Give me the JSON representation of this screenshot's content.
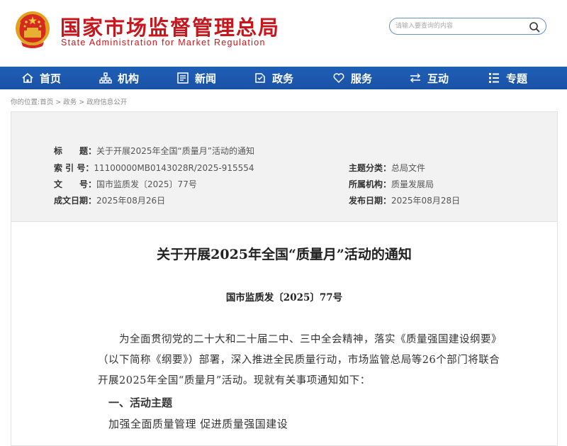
{
  "header": {
    "title": "国家市场监督管理总局",
    "subtitle": "State Administration for Market Regulation",
    "search_placeholder": "请输入要查询的内容",
    "search_icon": "search-icon"
  },
  "nav": {
    "items": [
      {
        "label": "首页",
        "icon": "home-icon"
      },
      {
        "label": "机构",
        "icon": "org-icon"
      },
      {
        "label": "新闻",
        "icon": "news-icon"
      },
      {
        "label": "政务",
        "icon": "affairs-icon"
      },
      {
        "label": "服务",
        "icon": "heart-icon"
      },
      {
        "label": "互动",
        "icon": "exchange-icon"
      },
      {
        "label": "专题",
        "icon": "topic-icon"
      }
    ]
  },
  "breadcrumb": {
    "prefix": "你的位置:",
    "items": [
      "首页",
      "政务",
      "政府信息公开"
    ],
    "separator": " > "
  },
  "meta": {
    "title_key": "标　　题：",
    "title_val": "关于开展2025年全国“质量月”活动的通知",
    "index_key": "索 引 号：",
    "index_val": "11100000MB0143028R/2025-915554",
    "category_key": "主题分类：",
    "category_val": "总局文件",
    "docno_key": "文　　号：",
    "docno_val": "国市监质发〔2025〕77号",
    "org_key": "所属机构：",
    "org_val": "质量发展局",
    "created_key": "成文日期：",
    "created_val": "2025年08月26日",
    "published_key": "发布日期：",
    "published_val": "2025年08月28日"
  },
  "document": {
    "title": "关于开展2025年全国“质量月”活动的通知",
    "number": "国市监质发〔2025〕77号",
    "paragraph": "为全面贯彻党的二十大和二十届二中、三中全会精神，落实《质量强国建设纲要》（以下简称《纲要》）部署，深入推进全民质量行动，市场监管总局等26个部门将联合开展2025年全国“质量月”活动。现就有关事项通知如下：",
    "section1_head": "一、活动主题",
    "section1_body": "加强全面质量管理 促进质量强国建设"
  },
  "colors": {
    "brand_red": "#c8161d",
    "nav_blue": "#1a52a6",
    "meta_bg": "#f2f2f2"
  }
}
